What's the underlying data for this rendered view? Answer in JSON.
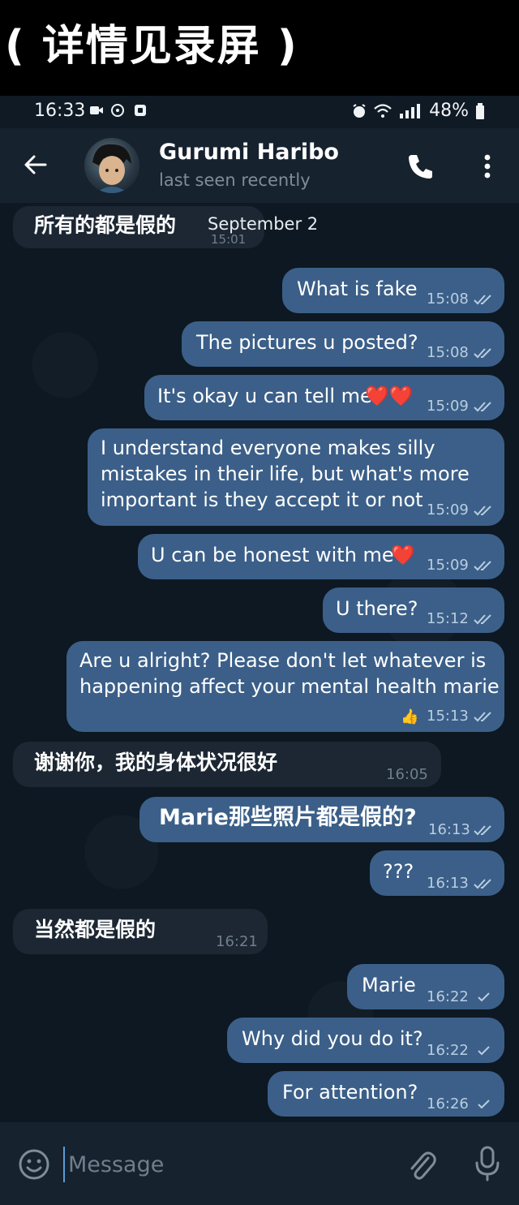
{
  "banner": {
    "text": "( 详情见录屏 )"
  },
  "status_bar": {
    "time": "16:33",
    "battery": "48%"
  },
  "header": {
    "name": "Gurumi Haribo",
    "status": "last seen recently"
  },
  "messages": [
    {
      "side": "in",
      "text": "所有的都是假的",
      "overlay": "September 2",
      "time": "15:01"
    },
    {
      "side": "out",
      "text": "What is fake",
      "time": "15:08",
      "read": true
    },
    {
      "side": "out",
      "text": "The pictures u posted?",
      "time": "15:08",
      "read": true
    },
    {
      "side": "out",
      "text": "It's okay u can tell me",
      "emoji": "❤️❤️",
      "time": "15:09",
      "read": true
    },
    {
      "side": "out",
      "lines": [
        "I understand everyone makes silly",
        "mistakes in their life, but what's more",
        "important is they accept it or not"
      ],
      "time": "15:09",
      "read": true
    },
    {
      "side": "out",
      "text": "U can be honest with me",
      "emoji": "❤️",
      "time": "15:09",
      "read": true
    },
    {
      "side": "out",
      "text": "U there?",
      "time": "15:12",
      "read": true
    },
    {
      "side": "out",
      "lines": [
        "Are u alright? Please don't let whatever is",
        "happening affect your mental health marie"
      ],
      "reaction": "👍",
      "time": "15:13",
      "read": true
    },
    {
      "side": "in",
      "text": "谢谢你，我的身体状况很好",
      "time": "16:05"
    },
    {
      "side": "out",
      "text": "Marie那些照片都是假的?",
      "time": "16:13",
      "read": true
    },
    {
      "side": "out",
      "text": "???",
      "time": "16:13",
      "read": true
    },
    {
      "side": "in",
      "text": "当然都是假的",
      "time": "16:21"
    },
    {
      "side": "out",
      "text": "Marie",
      "time": "16:22",
      "read": false
    },
    {
      "side": "out",
      "text": "Why did you do it?",
      "time": "16:22",
      "read": false
    },
    {
      "side": "out",
      "text": "For attention?",
      "time": "16:26",
      "read": false
    }
  ],
  "input": {
    "placeholder": "Message"
  },
  "colors": {
    "outgoing_bubble": "#3b5f88",
    "incoming_bubble": "#1c2733",
    "background": "#0d1822",
    "header": "#17222f"
  }
}
